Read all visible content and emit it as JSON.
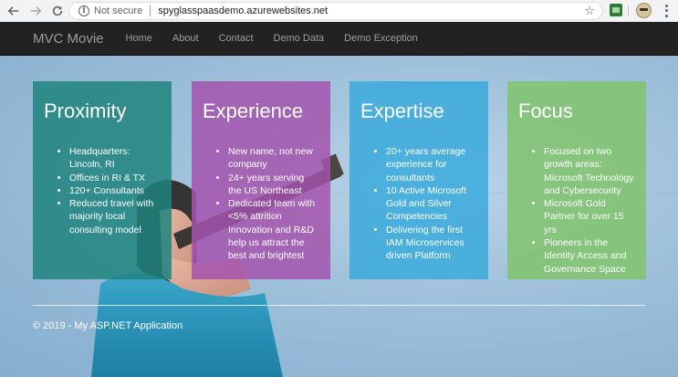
{
  "browser": {
    "security_text": "Not secure",
    "url": "spyglasspaasdemo.azurewebsites.net"
  },
  "navbar": {
    "brand": "MVC Movie",
    "links": [
      "Home",
      "About",
      "Contact",
      "Demo Data",
      "Demo Exception"
    ]
  },
  "cards": [
    {
      "title": "Proximity",
      "color": "#1e847e",
      "items": [
        "Headquarters: Lincoln, RI",
        "Offices in RI & TX",
        "120+ Consultants",
        "Reduced travel with majority local consulting model"
      ]
    },
    {
      "title": "Experience",
      "color": "#a454ae",
      "items": [
        "New name, not new company",
        "24+ years serving the US Northeast",
        "Dedicated team with <5% attrition Innovation and R&D help us attract the best and brightest"
      ]
    },
    {
      "title": "Expertise",
      "color": "#40acdd",
      "items": [
        "20+ years average experience for consultants",
        "10 Active Microsoft Gold and Silver Competencies",
        "Delivering the first IAM Microservices driven Platform"
      ]
    },
    {
      "title": "Focus",
      "color": "#82c470",
      "items": [
        "Focused on two growth areas: Microsoft Technology and Cybersecurity",
        "Microsoft Gold Partner for over 15 yrs",
        "Pioneers in the Identity Access and Governance Space"
      ]
    }
  ],
  "footer": {
    "text": "© 2019 - My ASP.NET Application"
  }
}
